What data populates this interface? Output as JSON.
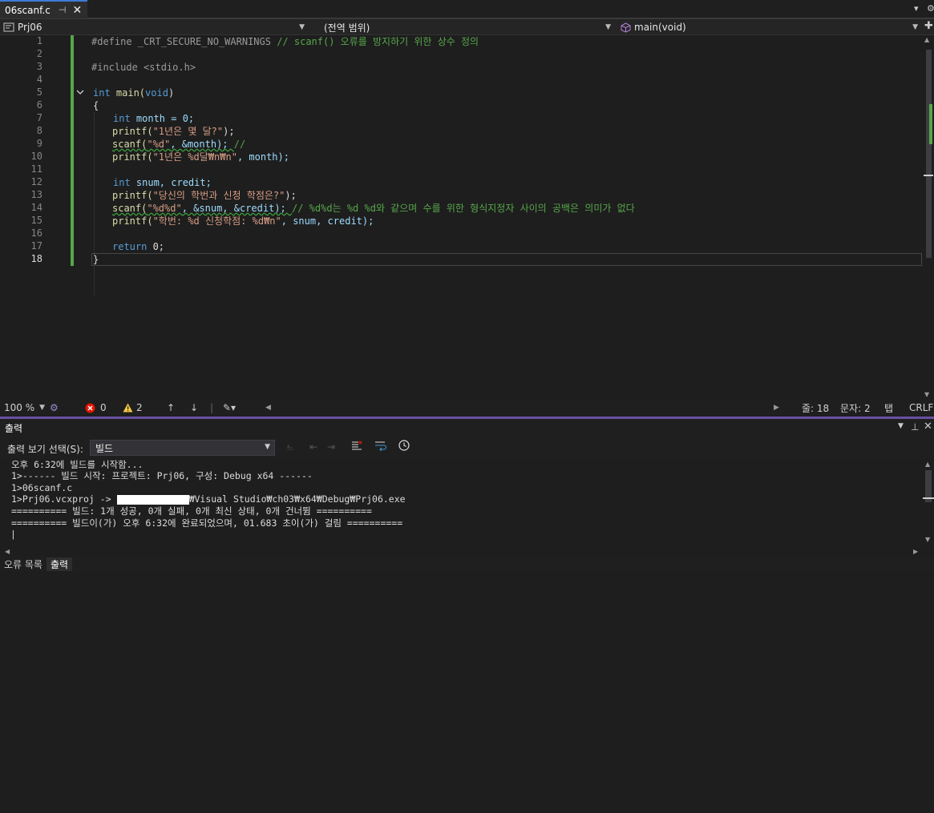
{
  "tab": {
    "title": "06scanf.c",
    "pin": "⊣",
    "close": "✕"
  },
  "window_controls": {
    "dropdown": "▾",
    "settings": "⚙"
  },
  "nav": {
    "project": "Prj06",
    "scope": "(전역 범위)",
    "function": "main(void)"
  },
  "code": {
    "line_numbers": [
      "1",
      "2",
      "3",
      "4",
      "5",
      "6",
      "7",
      "8",
      "9",
      "10",
      "11",
      "12",
      "13",
      "14",
      "15",
      "16",
      "17",
      "18"
    ],
    "l1_directive": "#define _CRT_SECURE_NO_WARNINGS",
    "l1_comment": " // scanf() 오류를 방지하기 위한 상수 정의",
    "l3_directive": "#include <stdio.h>",
    "l5_kw": "int",
    "l5_fn": " main(",
    "l5_param": "void",
    "l5_close": ")",
    "l6": "{",
    "l7_kw": "int",
    "l7_rest": " month = 0;",
    "l8_fn": "printf(",
    "l8_str": "\"1년은 몇 달?\"",
    "l8_end": ");",
    "l9_fn": "scanf(",
    "l9_str": "\"%d\"",
    "l9_mid": ", &month); ",
    "l9_comment": "//",
    "l10_fn": "printf(",
    "l10_str": "\"1년은 %d달₩n₩n\"",
    "l10_end": ", month);",
    "l12_kw": "int",
    "l12_rest": " snum, credit;",
    "l13_fn": "printf(",
    "l13_str": "\"당신의 학번과 신청 학점은?\"",
    "l13_end": ");",
    "l14_fn": "scanf(",
    "l14_str": "\"%d%d\"",
    "l14_mid": ", &snum, &credit); ",
    "l14_comment": "// %d%d는 %d %d와 같으며 수를 위한 형식지정자 사이의 공백은 의미가 없다",
    "l15_fn": "printf(",
    "l15_str": "\"학번: %d 신청학점: %d₩n\"",
    "l15_end": ", snum, credit);",
    "l17_kw": "return",
    "l17_rest": " 0;",
    "l18": "}"
  },
  "status": {
    "zoom": "100 %",
    "errors": "0",
    "warnings": "2",
    "line": "줄: 18",
    "char": "문자: 2",
    "tab_mode": "탭",
    "eol": "CRLF"
  },
  "output": {
    "title": "출력",
    "show_from_label": "출력 보기 선택(S):",
    "source": "빌드",
    "lines": [
      "오후 6:32에 빌드를 시작함...",
      "1>------ 빌드 시작: 프로젝트: Prj06, 구성: Debug x64 ------",
      "1>06scanf.c",
      "1>Prj06.vcxproj -> ",
      "========== 빌드: 1개 성공, 0개 실패, 0개 최신 상태, 0개 건너뜀 ==========",
      "========== 빌드이(가) 오후 6:32에 완료되었으며, 01.683 초이(가) 걸림 =========="
    ],
    "path_suffix": "₩Visual Studio₩ch03₩x64₩Debug₩Prj06.exe",
    "cursor": "|"
  },
  "bottom_tabs": [
    "오류 목록",
    "출력"
  ],
  "colors": {
    "accent": "#3e7bd6",
    "change_bar": "#57a64a",
    "divider": "#6a4fa0"
  }
}
